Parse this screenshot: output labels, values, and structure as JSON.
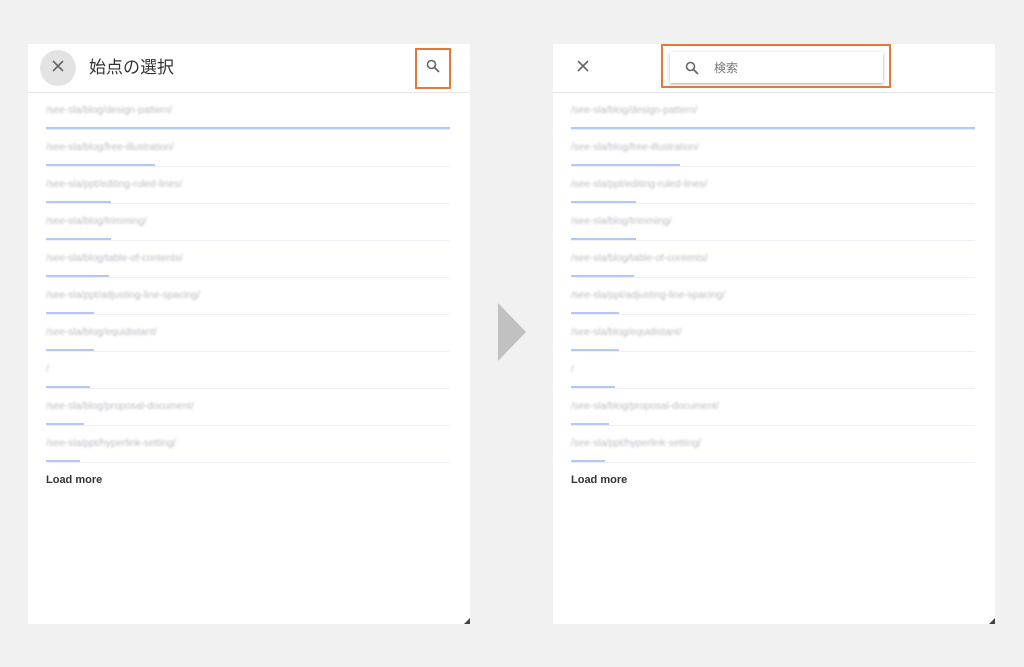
{
  "left_panel": {
    "title": "始点の選択",
    "close_icon": "close-icon",
    "search_icon": "search-icon",
    "load_more": "Load more"
  },
  "right_panel": {
    "search_placeholder": "検索",
    "close_icon": "close-icon",
    "search_icon": "search-icon",
    "load_more": "Load more"
  },
  "paths": [
    {
      "text": "/see-sla/blog/design-pattern/",
      "fraction": 1.0
    },
    {
      "text": "/see-sla/blog/free-illustration/",
      "fraction": 0.27
    },
    {
      "text": "/see-sla/ppt/editing-ruled-lines/",
      "fraction": 0.16
    },
    {
      "text": "/see-sla/blog/trimming/",
      "fraction": 0.16
    },
    {
      "text": "/see-sla/blog/table-of-contents/",
      "fraction": 0.155
    },
    {
      "text": "/see-sla/ppt/adjusting-line-spacing/",
      "fraction": 0.12
    },
    {
      "text": "/see-sla/blog/equidistant/",
      "fraction": 0.12
    },
    {
      "text": "/",
      "fraction": 0.11
    },
    {
      "text": "/see-sla/blog/proposal-document/",
      "fraction": 0.095
    },
    {
      "text": "/see-sla/ppt/hyperlink-setting/",
      "fraction": 0.085
    }
  ],
  "colors": {
    "highlight": "#e07a3a",
    "bar": "#b5c8f5",
    "arrow": "#c1c1c1"
  }
}
